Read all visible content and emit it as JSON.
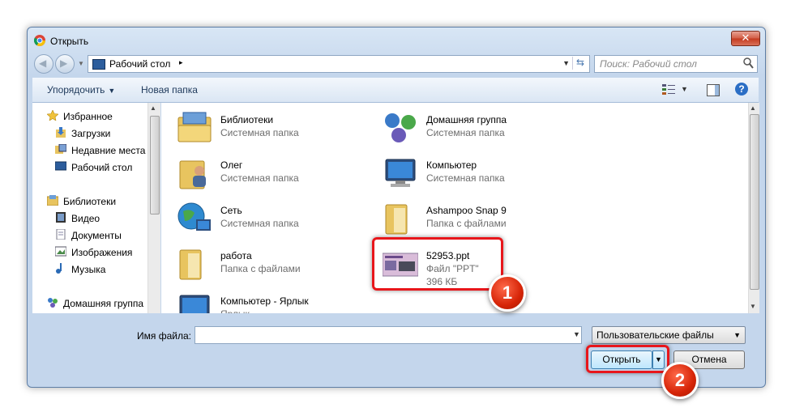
{
  "window": {
    "title": "Открыть",
    "close_label": "✕"
  },
  "address": {
    "location": "Рабочий стол",
    "separator": "▸"
  },
  "search": {
    "placeholder": "Поиск: Рабочий стол"
  },
  "toolbar": {
    "organize_label": "Упорядочить",
    "new_folder_label": "Новая папка"
  },
  "sidebar": {
    "items": [
      {
        "label": "Избранное",
        "icon": "star-icon"
      },
      {
        "label": "Загрузки",
        "icon": "downloads-icon"
      },
      {
        "label": "Недавние места",
        "icon": "recent-places-icon"
      },
      {
        "label": "Рабочий стол",
        "icon": "desktop-icon"
      },
      {
        "label": "Библиотеки",
        "icon": "libraries-icon"
      },
      {
        "label": "Видео",
        "icon": "video-icon"
      },
      {
        "label": "Документы",
        "icon": "documents-icon"
      },
      {
        "label": "Изображения",
        "icon": "pictures-icon"
      },
      {
        "label": "Музыка",
        "icon": "music-icon"
      },
      {
        "label": "Домашняя группа",
        "icon": "homegroup-icon"
      }
    ]
  },
  "files": [
    {
      "name": "Библиотеки",
      "type": "Системная папка",
      "icon": "libraries-folder-icon"
    },
    {
      "name": "Домашняя группа",
      "type": "Системная папка",
      "icon": "homegroup-icon"
    },
    {
      "name": "Олег",
      "type": "Системная папка",
      "icon": "user-folder-icon"
    },
    {
      "name": "Компьютер",
      "type": "Системная папка",
      "icon": "computer-icon"
    },
    {
      "name": "Сеть",
      "type": "Системная папка",
      "icon": "network-icon"
    },
    {
      "name": "Ashampoo Snap 9",
      "type": "Папка с файлами",
      "icon": "folder-icon"
    },
    {
      "name": "работа",
      "type": "Папка с файлами",
      "icon": "folder-icon"
    },
    {
      "name": "52953.ppt",
      "type": "Файл \"PPT\"",
      "size": "396 КБ",
      "icon": "ppt-file-icon"
    },
    {
      "name": "Компьютер - Ярлык",
      "type": "Ярлык",
      "icon": "computer-shortcut-icon"
    }
  ],
  "bottom": {
    "filename_label": "Имя файла:",
    "filename_value": "",
    "filter_label": "Пользовательские файлы",
    "open_label": "Открыть",
    "cancel_label": "Отмена"
  },
  "annotations": {
    "badge1": "1",
    "badge2": "2",
    "color": "#e8161b"
  }
}
